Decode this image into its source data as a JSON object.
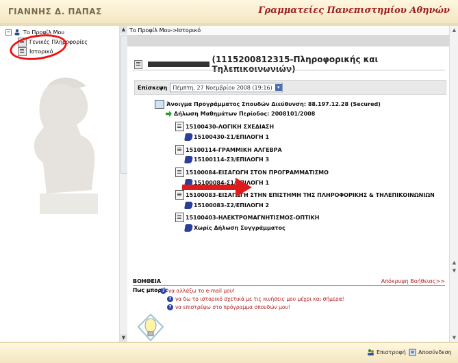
{
  "header": {
    "left_title": "ΓΙΑΝΝΗΣ Δ. ΠΑΠΑΣ",
    "right_title": "Γραμματείες Πανεπιστημίου Αθηνών"
  },
  "sidebar": {
    "root_label": "Το Προφίλ Μου",
    "items": [
      {
        "label": "Γενικές Πληροφορίες"
      },
      {
        "label": "Ιστορικό"
      }
    ]
  },
  "main": {
    "breadcrumb": "Το Προφίλ Μου->Ιστορικό",
    "student_title": "(1115200812315-Πληροφορικής και Τηλεπικοινωνιών)",
    "visit_label": "Επίσκεψη",
    "visit_value": "Πέμπτη, 27 Νοεμβρίου 2008 (19:16)",
    "tree": {
      "program": "Άνοιγμα Προγράμματος Σπουδών Διεύθυνση: 88.197.12.28 (Secured)",
      "declaration": "Δήλωση Μαθημάτων Περίοδος: 2008101/2008",
      "courses": [
        {
          "name": "15100430-ΛΟΓΙΚΗ ΣΧΕΔΙΑΣΗ",
          "book": "15100430-Σ1/ΕΠΙΛΟΓΗ 1"
        },
        {
          "name": "15100114-ΓΡΑΜΜΙΚΗ ΑΛΓΕΒΡΑ",
          "book": "15100114-Σ3/ΕΠΙΛΟΓΗ 3"
        },
        {
          "name": "15100084-ΕΙΣΑΓΩΓΗ ΣΤΟΝ ΠΡΟΓΡΑΜΜΑΤΙΣΜΟ",
          "book": "15100084-Σ1/ΕΠΙΛΟΓΗ 1"
        },
        {
          "name": "15100083-ΕΙΣΑΓΩΓΗ ΣΤΗΝ ΕΠΙΣΤΗΜΗ ΤΗΣ ΠΛΗΡΟΦΟΡΙΚΗΣ & ΤΗΛΕΠΙΚΟΙΝΩΝΙΩΝ",
          "book": "15100083-Σ2/ΕΠΙΛΟΓΗ 2"
        },
        {
          "name": "15100403-ΗΛΕΚΤΡΟΜΑΓΝΗΤΙΣΜΟΣ-ΟΠΤΙΚΗ",
          "book": "Χωρίς Δήλωση Συγγράμματος"
        }
      ]
    }
  },
  "help": {
    "title": "ΒΟΗΘΕΙΑ",
    "hide_link": "Απόκρυψη Βοήθειας>>",
    "question": "Πως μπορώ:",
    "links": [
      "να αλλάξω το e-mail μου!",
      "να δω το ιστορικό σχετικά με τις κινήσεις μου μέχρι και σήμερα!",
      "να επιστρέψω στο πρόγραμμα σπουδών μου!"
    ]
  },
  "footer": {
    "back_label": "Επιστροφή",
    "logout_label": "Αποσύνδεση"
  },
  "colors": {
    "accent_red": "#b01e1e",
    "header_bg": "#f3e6c2"
  }
}
